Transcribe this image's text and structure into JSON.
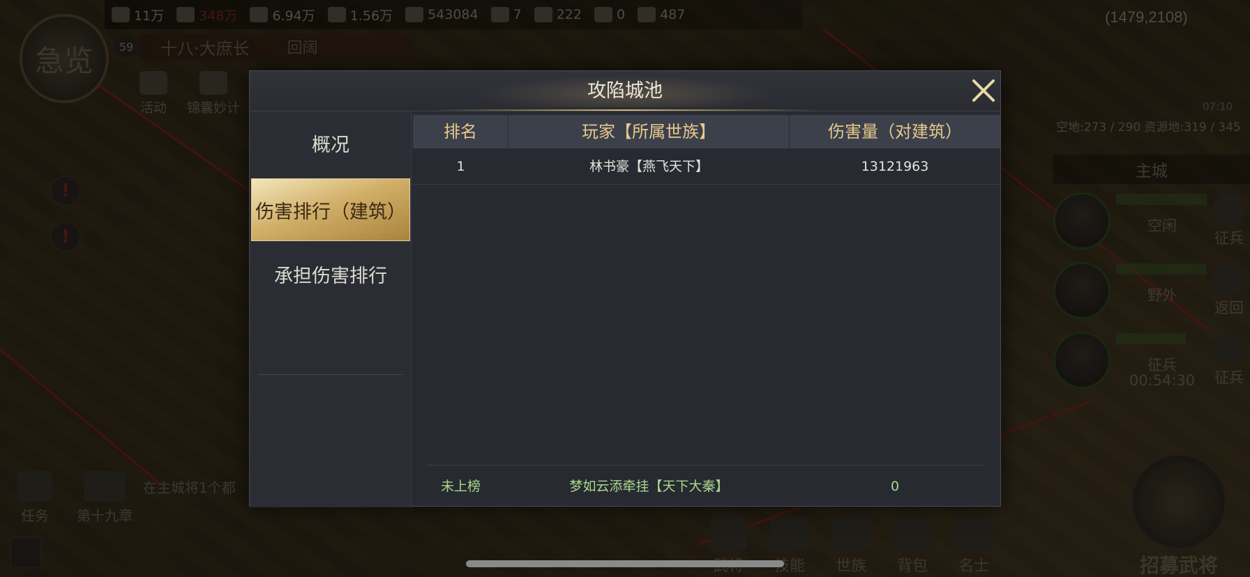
{
  "hud": {
    "resources": [
      {
        "icon": "grain-icon",
        "value": "11万"
      },
      {
        "icon": "wood-icon",
        "value": "348万",
        "warn": true
      },
      {
        "icon": "stone-icon",
        "value": "6.94万"
      },
      {
        "icon": "iron-icon",
        "value": "1.56万"
      },
      {
        "icon": "coin-icon",
        "value": "543084"
      },
      {
        "icon": "token-icon",
        "value": "7"
      },
      {
        "icon": "jade-icon",
        "value": "222"
      },
      {
        "icon": "gold-plus-icon",
        "value": "0"
      },
      {
        "icon": "gem-plus-icon",
        "value": "487"
      }
    ],
    "coordinates": "(1479,2108)",
    "player_level": "59",
    "rank_title": "十八·大庶长",
    "nation": "回阔",
    "avatar_glyph": "急览",
    "left_buttons": [
      {
        "label": "活动"
      },
      {
        "label": "锦囊妙计"
      }
    ],
    "land_info": "空地:273 / 290  资源地:319 / 345",
    "clock": "07:10",
    "main_city": "主城",
    "heroes": [
      {
        "status": "空闲",
        "timer": "",
        "action": "征兵",
        "bar": 1.0
      },
      {
        "status": "野外",
        "timer": "",
        "action": "返回",
        "bar": 1.0
      },
      {
        "status": "征兵",
        "timer": "00:54:30",
        "action": "征兵",
        "bar": 0.75
      }
    ],
    "quest_tip": "在主城将1个都",
    "bottom_left": [
      {
        "label": "任务"
      },
      {
        "label": "第十九章"
      }
    ],
    "bottom_nav": [
      {
        "label": "武将"
      },
      {
        "label": "技能"
      },
      {
        "label": "世族"
      },
      {
        "label": "背包"
      },
      {
        "label": "名士"
      }
    ],
    "recruit_label": "招募武将"
  },
  "modal": {
    "title": "攻陷城池",
    "tabs": [
      {
        "label": "概况",
        "active": false
      },
      {
        "label": "伤害排行（建筑）",
        "active": true
      },
      {
        "label": "承担伤害排行",
        "active": false
      }
    ],
    "columns": [
      "排名",
      "玩家【所属世族】",
      "伤害量（对建筑）"
    ],
    "rows": [
      {
        "rank": "1",
        "player": "林书豪【燕飞天下】",
        "damage": "13121963"
      }
    ],
    "self_row": {
      "rank": "未上榜",
      "player": "梦如云添牵挂【天下大秦】",
      "damage": "0"
    }
  },
  "colors": {
    "header_text": "#e8c98b",
    "self_row_text": "#a9d88e",
    "active_tab_gold": "#d2b069"
  }
}
